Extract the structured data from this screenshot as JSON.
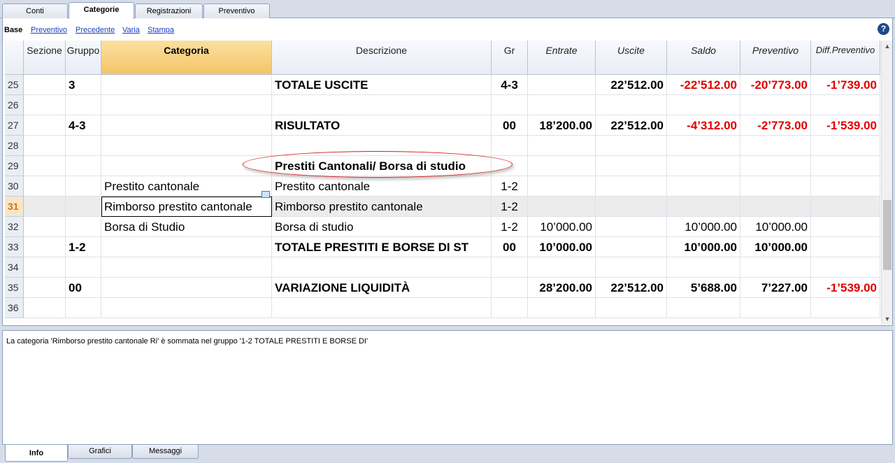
{
  "top_tabs": [
    "Conti",
    "Categorie",
    "Registrazioni",
    "Preventivo"
  ],
  "views": [
    "Base",
    "Preventivo",
    "Precedente",
    "Varia",
    "Stampa"
  ],
  "help_label": "?",
  "columns": [
    "Sezione",
    "Gruppo",
    "Categoria",
    "Descrizione",
    "Gr",
    "Entrate",
    "Uscite",
    "Saldo",
    "Preventivo",
    "Diff.Preventivo"
  ],
  "rows": [
    {
      "num": "25",
      "sezione": "",
      "gruppo": "3",
      "categoria": "",
      "descrizione": "TOTALE USCITE",
      "gr": "4-3",
      "entrate": "",
      "uscite": "22’512.00",
      "saldo": "-22’512.00",
      "preventivo": "-20’773.00",
      "diff": "-1’739.00"
    },
    {
      "num": "26",
      "sezione": "",
      "gruppo": "",
      "categoria": "",
      "descrizione": "",
      "gr": "",
      "entrate": "",
      "uscite": "",
      "saldo": "",
      "preventivo": "",
      "diff": ""
    },
    {
      "num": "27",
      "sezione": "",
      "gruppo": "4-3",
      "categoria": "",
      "descrizione": "RISULTATO",
      "gr": "00",
      "entrate": "18’200.00",
      "uscite": "22’512.00",
      "saldo": "-4’312.00",
      "preventivo": "-2’773.00",
      "diff": "-1’539.00"
    },
    {
      "num": "28",
      "sezione": "",
      "gruppo": "",
      "categoria": "",
      "descrizione": "",
      "gr": "",
      "entrate": "",
      "uscite": "",
      "saldo": "",
      "preventivo": "",
      "diff": ""
    },
    {
      "num": "29",
      "sezione": "",
      "gruppo": "",
      "categoria": "",
      "descrizione": "Prestiti Cantonali/ Borsa di studio",
      "gr": "",
      "entrate": "",
      "uscite": "",
      "saldo": "",
      "preventivo": "",
      "diff": ""
    },
    {
      "num": "30",
      "sezione": "",
      "gruppo": "",
      "categoria": "Prestito cantonale",
      "descrizione": "Prestito cantonale",
      "gr": "1-2",
      "entrate": "",
      "uscite": "",
      "saldo": "",
      "preventivo": "",
      "diff": ""
    },
    {
      "num": "31",
      "sezione": "",
      "gruppo": "",
      "categoria": "Rimborso prestito cantonale",
      "descrizione": "Rimborso prestito cantonale",
      "gr": "1-2",
      "entrate": "",
      "uscite": "",
      "saldo": "",
      "preventivo": "",
      "diff": ""
    },
    {
      "num": "32",
      "sezione": "",
      "gruppo": "",
      "categoria": "Borsa di Studio",
      "descrizione": "Borsa di studio",
      "gr": "1-2",
      "entrate": "10’000.00",
      "uscite": "",
      "saldo": "10’000.00",
      "preventivo": "10’000.00",
      "diff": ""
    },
    {
      "num": "33",
      "sezione": "",
      "gruppo": "1-2",
      "categoria": "",
      "descrizione": "TOTALE PRESTITI E BORSE DI ST",
      "gr": "00",
      "entrate": "10’000.00",
      "uscite": "",
      "saldo": "10’000.00",
      "preventivo": "10’000.00",
      "diff": ""
    },
    {
      "num": "34",
      "sezione": "",
      "gruppo": "",
      "categoria": "",
      "descrizione": "",
      "gr": "",
      "entrate": "",
      "uscite": "",
      "saldo": "",
      "preventivo": "",
      "diff": ""
    },
    {
      "num": "35",
      "sezione": "",
      "gruppo": "00",
      "categoria": "",
      "descrizione": "VARIAZIONE LIQUIDITÀ",
      "gr": "",
      "entrate": "28’200.00",
      "uscite": "22’512.00",
      "saldo": "5’688.00",
      "preventivo": "7’227.00",
      "diff": "-1’539.00"
    },
    {
      "num": "36",
      "sezione": "",
      "gruppo": "",
      "categoria": "",
      "descrizione": "",
      "gr": "",
      "entrate": "",
      "uscite": "",
      "saldo": "",
      "preventivo": "",
      "diff": ""
    }
  ],
  "info_message": "La categoria 'Rimborso prestito cantonale Ri' è sommata nel gruppo '1-2 TOTALE PRESTITI E BORSE DI'",
  "bottom_tabs": [
    "Info",
    "Grafici",
    "Messaggi"
  ],
  "colors": {
    "negative": "#e00000",
    "selected_header": "#f4c468",
    "accent_tab": "#1a3fbf"
  }
}
